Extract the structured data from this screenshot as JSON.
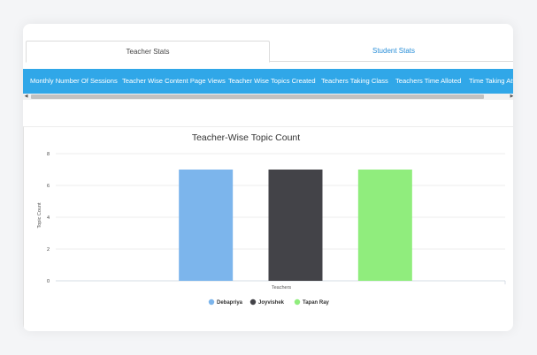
{
  "tabs": [
    {
      "label": "Teacher Stats",
      "active": true
    },
    {
      "label": "Student Stats",
      "active": false
    }
  ],
  "nav": {
    "items": [
      "Monthly Number Of Sessions",
      "Teacher Wise Content Page Views",
      "Teacher Wise Topics Created",
      "Teachers Taking Class",
      "Teachers Time Alloted",
      "Time Taking Atte"
    ],
    "color": "#30a7e8"
  },
  "scrollbar": {
    "left_arrow": "◀",
    "right_arrow": "▶"
  },
  "chart_data": {
    "type": "bar",
    "title": "Teacher-Wise Topic Count",
    "xlabel": "Teachers",
    "ylabel": "Topic Count",
    "ylim": [
      0,
      8
    ],
    "yticks": [
      "0",
      "2",
      "4",
      "6",
      "8"
    ],
    "grid": true,
    "legend_position": "bottom",
    "series": [
      {
        "name": "Debapriya",
        "value": 7,
        "color": "#7cb5ec"
      },
      {
        "name": "Joyvishek",
        "value": 7,
        "color": "#434348"
      },
      {
        "name": "Tapan Ray",
        "value": 7,
        "color": "#90ed7d"
      }
    ]
  }
}
